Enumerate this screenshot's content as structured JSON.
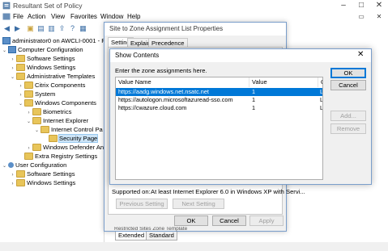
{
  "window": {
    "title": "Resultant Set of Policy"
  },
  "menu": [
    "File",
    "Action",
    "View",
    "Favorites",
    "Window",
    "Help"
  ],
  "tree": {
    "root": "administrator0 on AWCLI-0001 - RSoP",
    "computer_configuration": "Computer Configuration",
    "software_settings": "Software Settings",
    "windows_settings": "Windows Settings",
    "administrative_templates": "Administrative Templates",
    "citrix_components": "Citrix Components",
    "system": "System",
    "windows_components": "Windows Components",
    "biometrics": "Biometrics",
    "internet_explorer": "Internet Explorer",
    "internet_control_panel": "Internet Control Pa",
    "security_page": "Security Page",
    "windows_defender": "Windows Defender An",
    "extra_registry": "Extra Registry Settings",
    "user_configuration": "User Configuration",
    "user_software_settings": "Software Settings",
    "user_windows_settings": "Windows Settings"
  },
  "properties": {
    "title": "Site to Zone Assignment List Properties",
    "tabs": [
      "Setting",
      "Explain",
      "Precedence"
    ],
    "supported_on_label": "Supported on:",
    "supported_on_value": "At least Internet Explorer 6.0 in Windows XP with Servi...",
    "previous_setting": "Previous Setting",
    "next_setting": "Next Setting",
    "ok": "OK",
    "cancel": "Cancel",
    "apply": "Apply"
  },
  "show_contents": {
    "title": "Show Contents",
    "instruction": "Enter the zone assignments here.",
    "columns": [
      "Value Name",
      "Value",
      "C"
    ],
    "rows": [
      {
        "name": "https://aadg.windows.net.nsatc.net",
        "value": "1",
        "c": "L",
        "selected": true
      },
      {
        "name": "https://autologon.microsoftazuread-sso.com",
        "value": "1",
        "c": "L",
        "selected": false
      },
      {
        "name": "https://cwazure.cloud.com",
        "value": "1",
        "c": "L",
        "selected": false
      }
    ],
    "ok": "OK",
    "cancel": "Cancel",
    "add": "Add...",
    "remove": "Remove"
  },
  "bottom_tabs": [
    "Extended",
    "Standard"
  ],
  "partial_text": "Restricted Sites Zone Template"
}
